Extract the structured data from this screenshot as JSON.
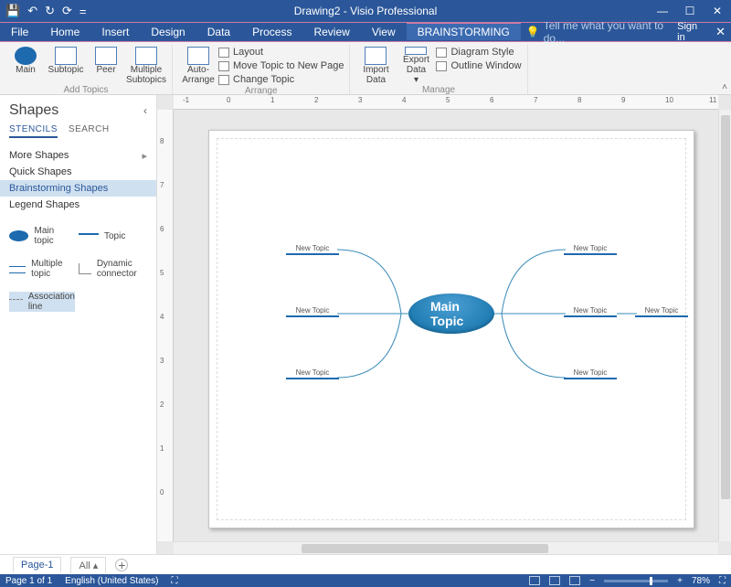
{
  "title": "Drawing2 - Visio Professional",
  "qat": {
    "save": "💾",
    "undo": "↶",
    "redo": "↻",
    "custom": "▾",
    "sync": "⟳",
    "eq": "="
  },
  "win": {
    "min": "—",
    "max": "☐",
    "close": "✕"
  },
  "tabs": [
    "File",
    "Home",
    "Insert",
    "Design",
    "Data",
    "Process",
    "Review",
    "View",
    "BRAINSTORMING"
  ],
  "tellme": "Tell me what you want to do...",
  "signin": "Sign in",
  "ribbon": {
    "addtopics": {
      "label": "Add Topics",
      "main": "Main",
      "subtopic": "Subtopic",
      "peer": "Peer",
      "multi1": "Multiple",
      "multi2": "Subtopics"
    },
    "arrange": {
      "label": "Arrange",
      "auto1": "Auto-",
      "auto2": "Arrange",
      "layout": "Layout",
      "move": "Move Topic to New Page",
      "change": "Change Topic"
    },
    "manage": {
      "label": "Manage",
      "import1": "Import",
      "import2": "Data",
      "export1": "Export",
      "export2": "Data",
      "diagram": "Diagram Style",
      "outline": "Outline Window"
    }
  },
  "shapes": {
    "title": "Shapes",
    "stencils": "STENCILS",
    "search": "SEARCH",
    "more": "More Shapes",
    "quick": "Quick Shapes",
    "brain": "Brainstorming Shapes",
    "legend": "Legend Shapes",
    "palette": {
      "main": "Main topic",
      "topic": "Topic",
      "multi": "Multiple topic",
      "dyn": "Dynamic connector",
      "assoc": "Association line"
    }
  },
  "ruler_top": [
    "-1",
    "0",
    "1",
    "2",
    "3",
    "4",
    "5",
    "6",
    "7",
    "8",
    "9",
    "10",
    "11"
  ],
  "ruler_left": [
    "8",
    "7",
    "6",
    "5",
    "4",
    "3",
    "2",
    "1",
    "0"
  ],
  "diagram": {
    "main": "Main Topic",
    "nt": "New Topic"
  },
  "pagetabs": {
    "page1": "Page-1",
    "all": "All"
  },
  "status": {
    "page": "Page 1 of 1",
    "lang": "English (United States)",
    "zoom": "78%"
  }
}
